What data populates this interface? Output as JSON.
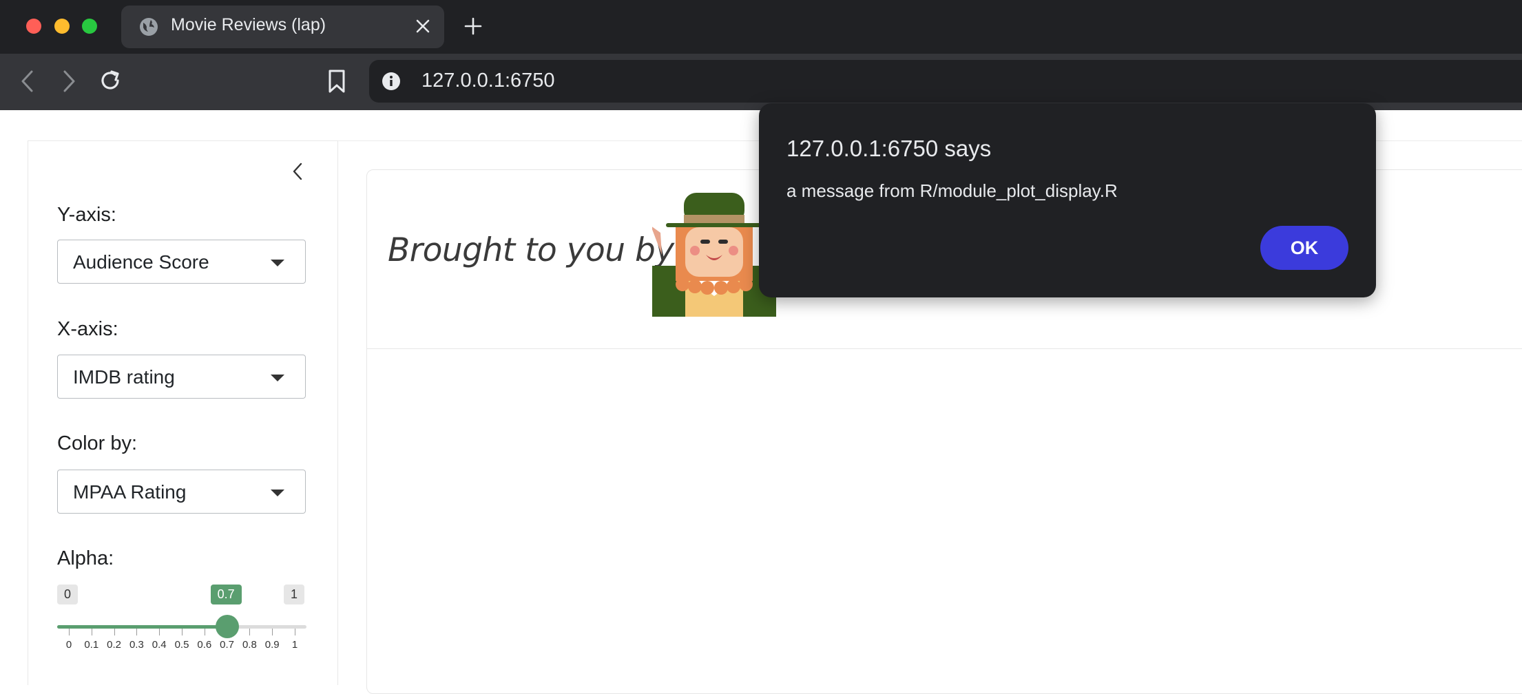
{
  "browser": {
    "tab_title": "Movie Reviews (lap)",
    "url": "127.0.0.1:6750",
    "icons": [
      "close-window-icon",
      "minimize-window-icon",
      "zoom-window-icon",
      "globe-icon",
      "close-tab-icon",
      "new-tab-icon",
      "back-icon",
      "forward-icon",
      "reload-icon",
      "bookmark-icon",
      "site-info-icon"
    ],
    "colors": {
      "close": "#ff5f57",
      "minimize": "#febc2e",
      "zoom": "#28c840"
    }
  },
  "sidebar": {
    "collapse_icon": "chevron-left-icon",
    "y_axis": {
      "label": "Y-axis:",
      "value": "Audience Score"
    },
    "x_axis": {
      "label": "X-axis:",
      "value": "IMDB rating"
    },
    "color_by": {
      "label": "Color by:",
      "value": "MPAA Rating"
    },
    "alpha": {
      "label": "Alpha:",
      "min": "0",
      "max": "1",
      "value": "0.7",
      "value_fraction": 0.7,
      "ticks": [
        "0",
        "0.1",
        "0.2",
        "0.3",
        "0.4",
        "0.5",
        "0.6",
        "0.7",
        "0.8",
        "0.9",
        "1"
      ],
      "accent_color": "#5a9e6f"
    }
  },
  "main": {
    "brought_by": "Brought to you by",
    "mascot": "leprechaun-illustration"
  },
  "dialog": {
    "title": "127.0.0.1:6750 says",
    "message": "a message from R/module_plot_display.R",
    "ok_label": "OK",
    "button_color": "#3b3bdc"
  }
}
